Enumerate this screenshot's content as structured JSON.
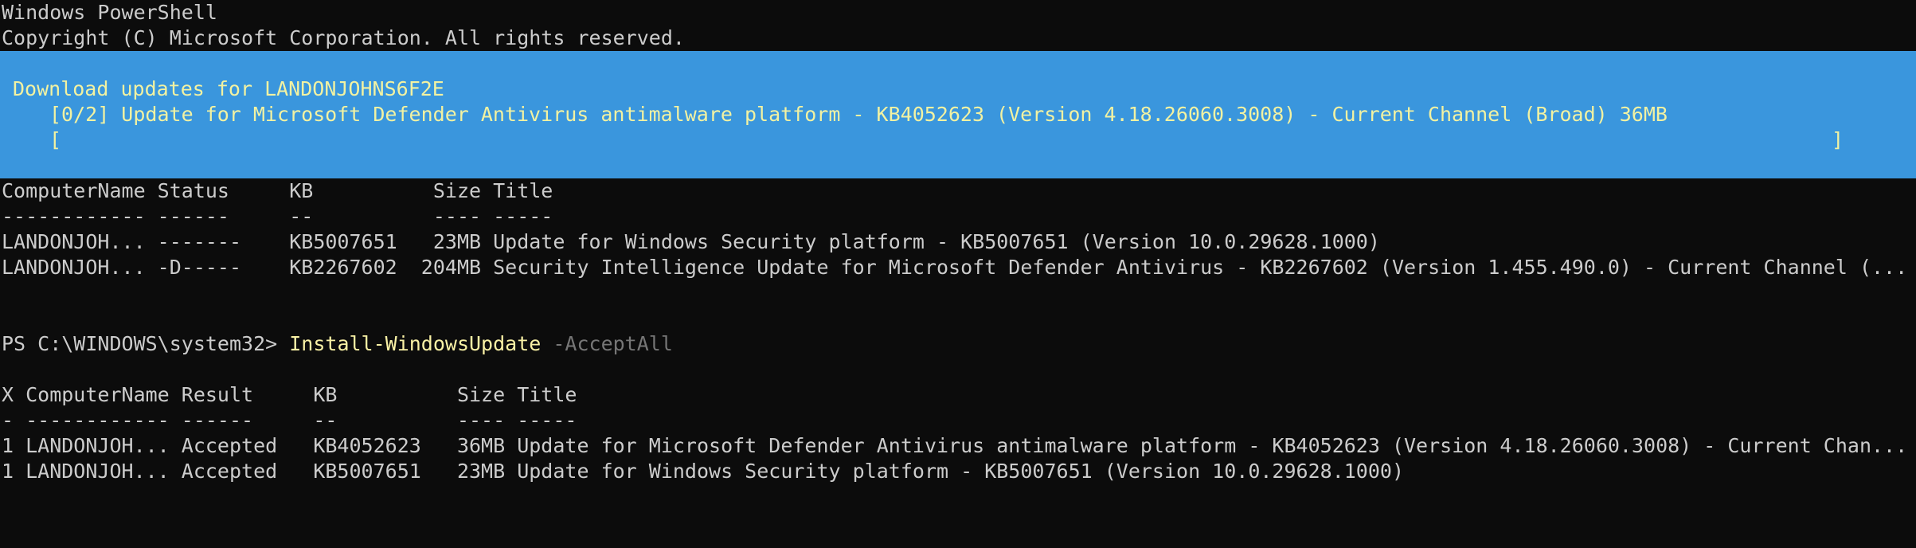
{
  "header": {
    "title": "Windows PowerShell",
    "copyright": "Copyright (C) Microsoft Corporation. All rights reserved."
  },
  "progress": {
    "activity": "Download updates for LANDONJOHNS6F2E",
    "status": "[0/2] Update for Microsoft Defender Antivirus antimalware platform - KB4052623 (Version 4.18.26060.3008) - Current Channel (Broad) 36MB",
    "bar_open": "[",
    "bar_close": "]",
    "fraction_complete": 0
  },
  "table1": {
    "header": "ComputerName Status     KB          Size Title",
    "separator": "------------ ------     --          ---- -----",
    "rows": [
      "LANDONJOH... -------    KB5007651   23MB Update for Windows Security platform - KB5007651 (Version 10.0.29628.1000)",
      "LANDONJOH... -D-----    KB2267602  204MB Security Intelligence Update for Microsoft Defender Antivirus - KB2267602 (Version 1.455.490.0) - Current Channel (..."
    ]
  },
  "command": {
    "prompt": "PS C:\\WINDOWS\\system32> ",
    "cmdlet": "Install-WindowsUpdate",
    "parameter": " -AcceptAll"
  },
  "table2": {
    "header": "X ComputerName Result     KB          Size Title",
    "separator": "- ------------ ------     --          ---- -----",
    "rows": [
      "1 LANDONJOH... Accepted   KB4052623   36MB Update for Microsoft Defender Antivirus antimalware platform - KB4052623 (Version 4.18.26060.3008) - Current Chan...",
      "1 LANDONJOH... Accepted   KB5007651   23MB Update for Windows Security platform - KB5007651 (Version 10.0.29628.1000)"
    ]
  },
  "colors": {
    "background": "#0c0c0c",
    "foreground": "#cccccc",
    "progress_background": "#3a96dd",
    "progress_foreground": "#f2f2a2",
    "cmdlet": "#f9f1a5",
    "parameter": "#767676"
  }
}
